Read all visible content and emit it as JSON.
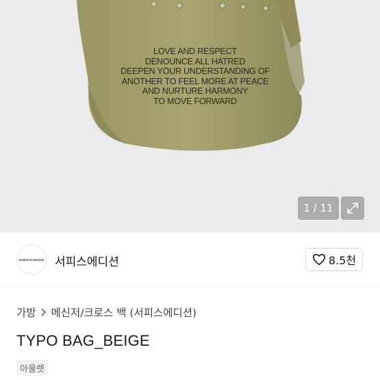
{
  "product_image": {
    "printed_text": [
      "LOVE AND RESPECT",
      "DENOUNCE ALL HATRED",
      "DEEPEN YOUR UNDERSTANDING OF",
      "ANOTHER TO FEEL MORE AT PEACE",
      "AND NURTURE HARMONY",
      "TO MOVE FORWARD"
    ],
    "counter": "1 / 11",
    "expand_icon": "expand-icon",
    "bag_color": "#a8a271"
  },
  "seller": {
    "logo_text": "SURFACE EDITION",
    "name": "서피스에디션",
    "likes": "8.5천",
    "heart_icon": "heart-outline-icon"
  },
  "breadcrumb": {
    "items": [
      "가방",
      "메신저/크로스 백 (서피스에디션)"
    ],
    "separator_icon": "chevron-right-icon"
  },
  "product": {
    "title": "TYPO BAG_BEIGE",
    "tag": "아울렛"
  }
}
